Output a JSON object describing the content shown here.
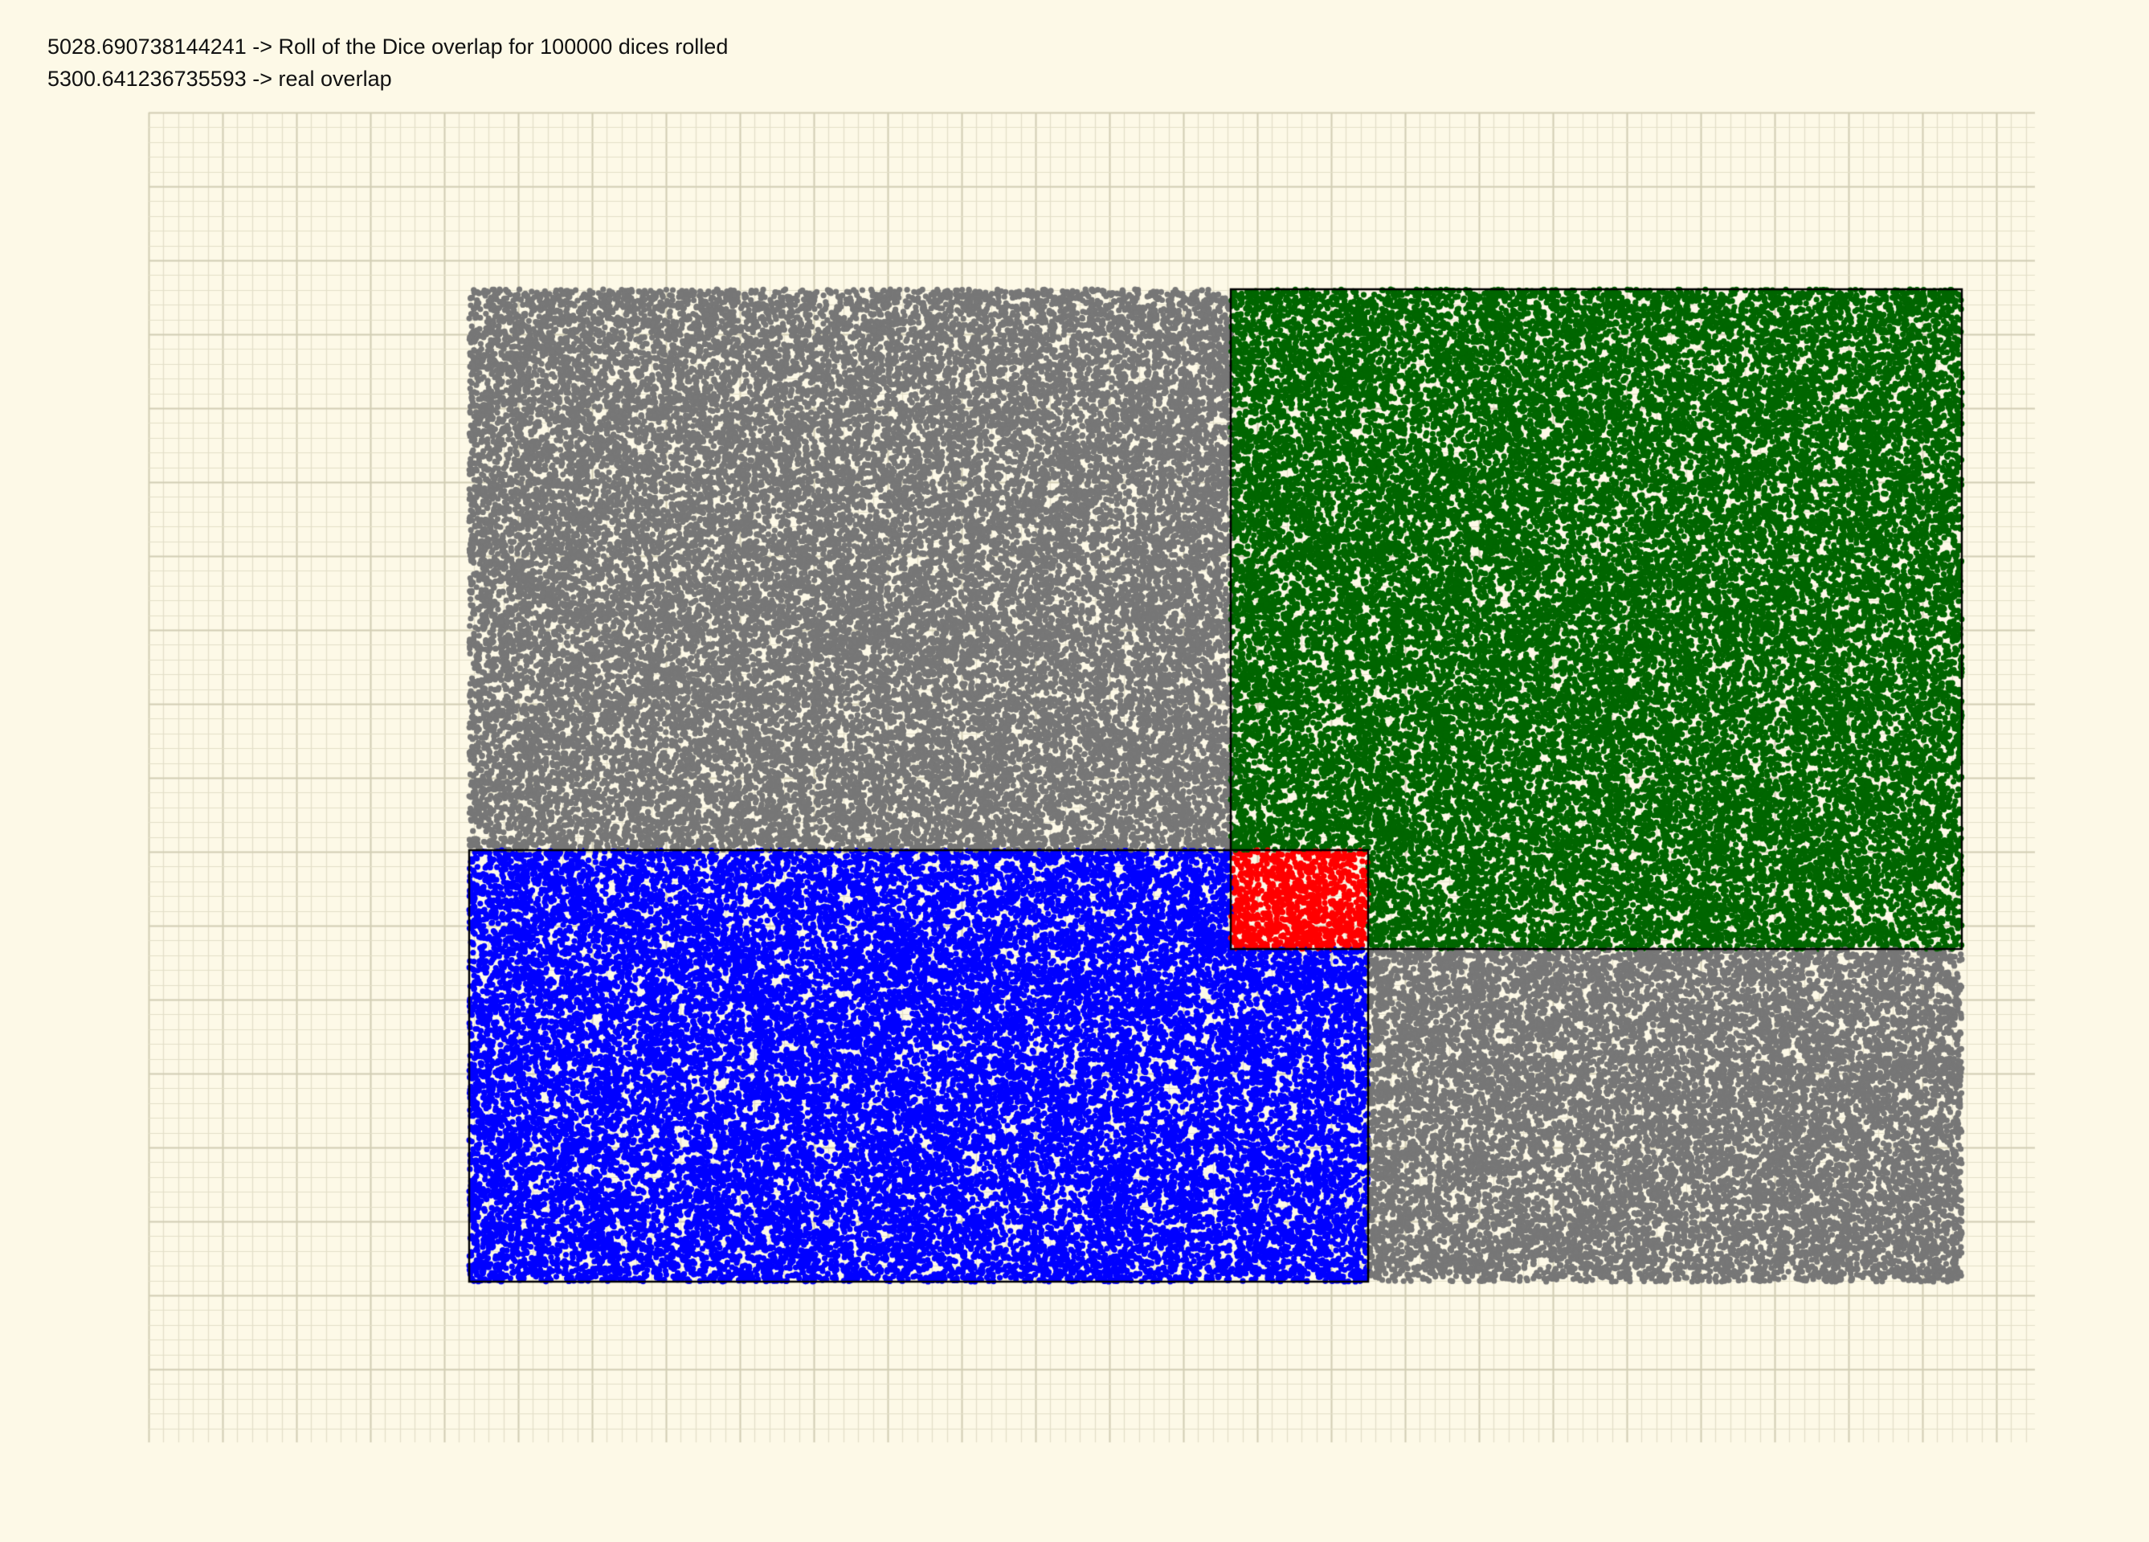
{
  "output": {
    "estimate_line": "5028.690738144241 -> Roll of the Dice overlap for 100000 dices rolled",
    "real_line": "5300.641236735593 -> real overlap"
  },
  "simulation": {
    "dice_rolled": 100000,
    "estimated_overlap": 5028.690738144241,
    "real_overlap": 5300.641236735593,
    "colors": {
      "background": "#fdf9e7",
      "grid_minor": "#e3dfc8",
      "grid_major": "#d2cdb4",
      "outside": "#777777",
      "blue_rect": "#0000ff",
      "green_rect": "#006600",
      "overlap": "#ff0000",
      "outline": "#000000"
    }
  }
}
